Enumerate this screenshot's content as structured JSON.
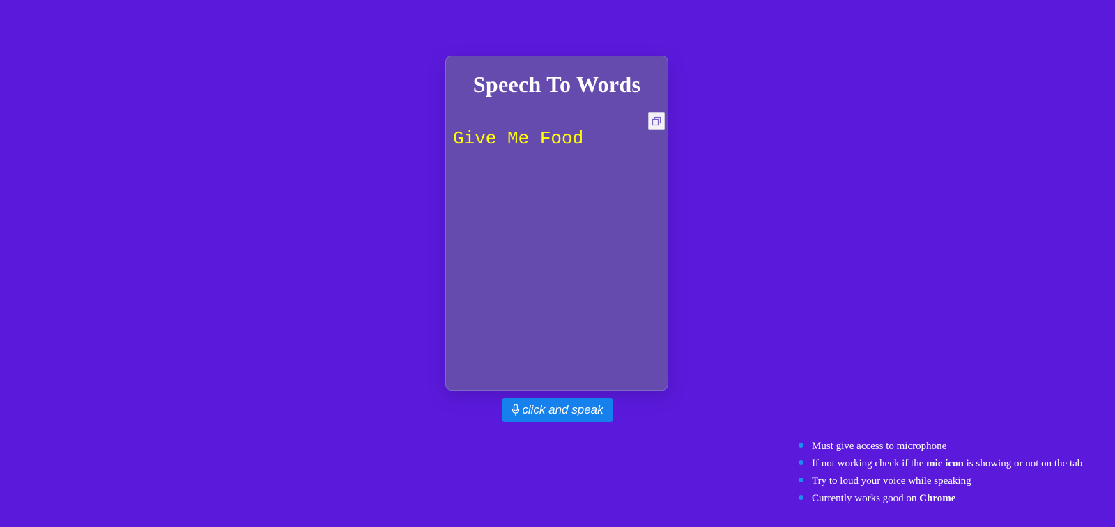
{
  "app": {
    "title": "Speech To Words",
    "background_color": "#5b1adb",
    "card_color": "#654bad"
  },
  "transcript": {
    "text": "Give Me Food",
    "color": "#ffff00"
  },
  "copy_button": {
    "icon": "copy-icon"
  },
  "speak_button": {
    "label": "click and speak",
    "icon": "mic-icon",
    "color": "#1681ec"
  },
  "notes": {
    "bullet_color": "#1b8ef2",
    "items": [
      {
        "text": "Must give access to microphone"
      },
      {
        "pre": "If not working check if the ",
        "bold": "mic icon",
        "post": " is showing or not on the tab"
      },
      {
        "text": "Try to loud your voice while speaking"
      },
      {
        "pre": "Currently works good on ",
        "bold": "Chrome"
      }
    ]
  }
}
